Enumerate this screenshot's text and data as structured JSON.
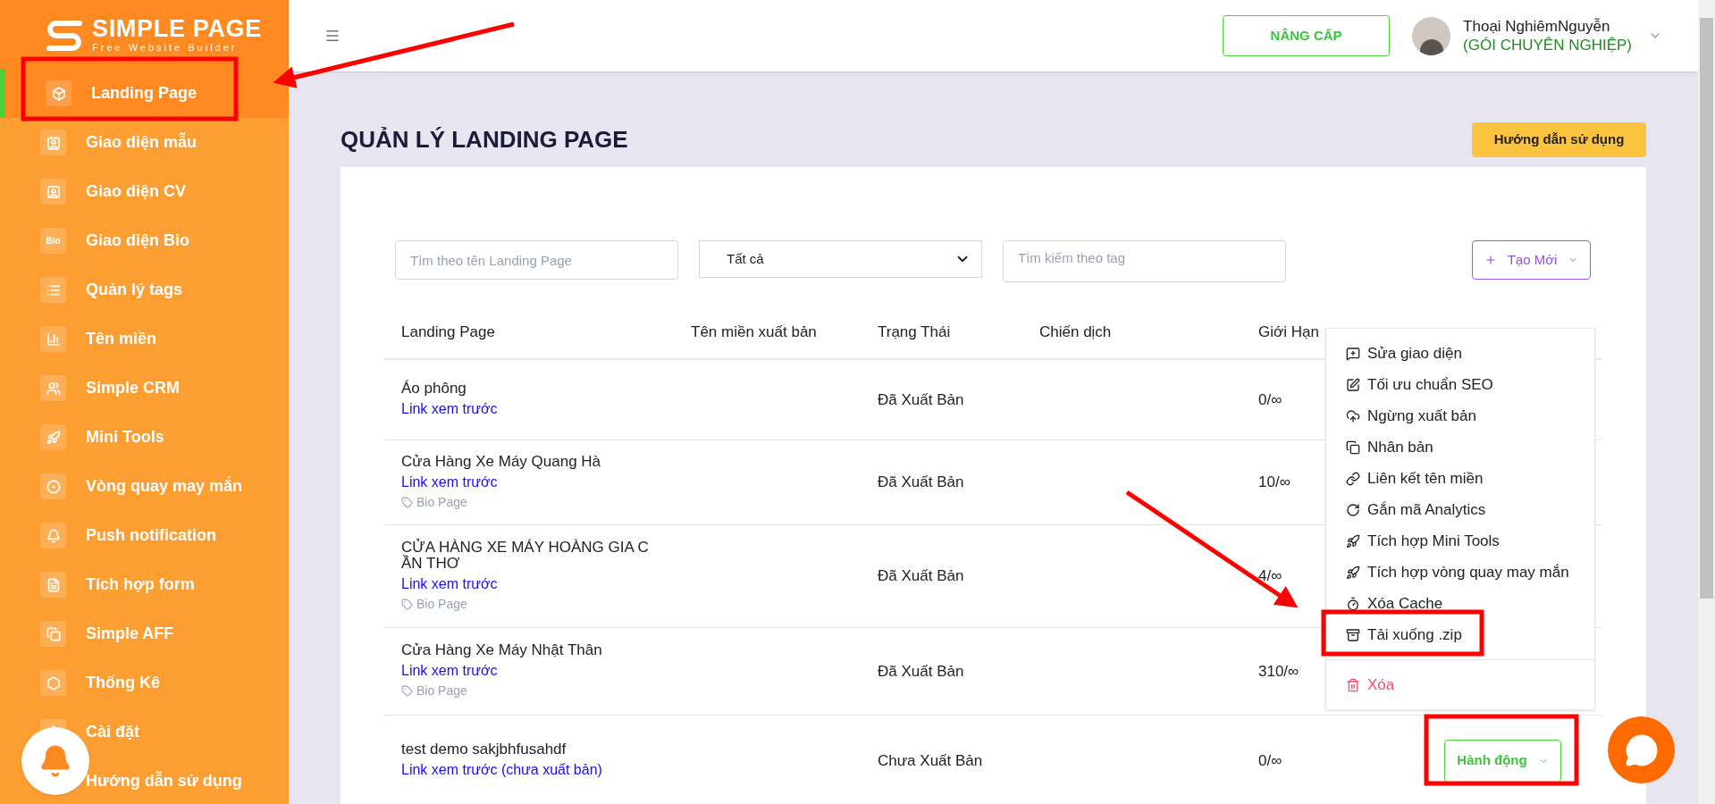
{
  "brand": {
    "name": "SIMPLE PAGE",
    "tagline": "Free Website Builder"
  },
  "sidebar": {
    "items": [
      {
        "label": "Landing Page",
        "selected": true
      },
      {
        "label": "Giao diện mẫu",
        "selected": false
      },
      {
        "label": "Giao diện CV",
        "selected": false
      },
      {
        "label": "Giao diện Bio",
        "selected": false,
        "icon_text": "Bio"
      },
      {
        "label": "Quản lý tags",
        "selected": false
      },
      {
        "label": "Tên miền",
        "selected": false
      },
      {
        "label": "Simple CRM",
        "selected": false
      },
      {
        "label": "Mini Tools",
        "selected": false
      },
      {
        "label": "Vòng quay may mắn",
        "selected": false
      },
      {
        "label": "Push notification",
        "selected": false
      },
      {
        "label": "Tích hợp form",
        "selected": false
      },
      {
        "label": "Simple AFF",
        "selected": false
      },
      {
        "label": "Thống Kê",
        "selected": false
      },
      {
        "label": "Cài đặt",
        "selected": false
      },
      {
        "label": "Hướng dẫn sử dụng",
        "selected": false
      }
    ]
  },
  "topbar": {
    "upgrade_button": "NÂNG CẤP",
    "user": {
      "name": "Thoại NghiêmNguyễn",
      "plan": "(GÓI CHUYÊN NGHIỆP)"
    }
  },
  "page": {
    "title": "QUẢN LÝ LANDING PAGE",
    "guide_button": "Hướng dẫn sử dụng"
  },
  "filters": {
    "name_search": {
      "placeholder": "Tìm theo tên Landing Page"
    },
    "status_select": {
      "value": "Tất cả"
    },
    "tag_search": {
      "placeholder": "Tìm kiếm theo tag"
    },
    "create_button": "Tạo Mới"
  },
  "table": {
    "columns": [
      "Landing Page",
      "Tên miền xuất bản",
      "Trạng Thái",
      "Chiến dịch",
      "Giới Hạn"
    ],
    "rows": [
      {
        "name": "Áo phông",
        "link": "Link xem trước",
        "status": "Đã Xuất Bản",
        "limit": "0/∞"
      },
      {
        "name": "Cửa Hàng Xe Máy Quang Hà",
        "link": "Link xem trước",
        "tag": "Bio Page",
        "status": "Đã Xuất Bản",
        "limit": "10/∞"
      },
      {
        "name": "CỬA HÀNG XE MÁY HOÀNG GIA C\nẦN THƠ",
        "link": "Link xem trước",
        "tag": "Bio Page",
        "status": "Đã Xuất Bản",
        "limit": "4/∞"
      },
      {
        "name": "Cửa Hàng Xe Máy Nhật Thân",
        "link": "Link xem trước",
        "tag": "Bio Page",
        "status": "Đã Xuất Bản",
        "limit": "310/∞"
      },
      {
        "name": "test demo sakjbhfusahdf",
        "link": "Link xem trước (chưa xuất bản)",
        "status": "Chưa Xuất Bản",
        "limit": "0/∞",
        "action": "Hành động"
      }
    ]
  },
  "action_menu": {
    "items": [
      {
        "label": "Sửa giao diện",
        "kind": "normal"
      },
      {
        "label": "Tối ưu chuẩn SEO",
        "kind": "normal"
      },
      {
        "label": "Ngừng xuất bản",
        "kind": "normal"
      },
      {
        "label": "Nhân bản",
        "kind": "normal"
      },
      {
        "label": "Liên kết tên miền",
        "kind": "normal"
      },
      {
        "label": "Gắn mã Analytics",
        "kind": "normal"
      },
      {
        "label": "Tích hợp Mini Tools",
        "kind": "normal"
      },
      {
        "label": "Tích hợp vòng quay may mắn",
        "kind": "normal"
      },
      {
        "label": "Xóa Cache",
        "kind": "normal"
      },
      {
        "label": "Tải xuống .zip",
        "kind": "normal"
      },
      {
        "label": "Xóa",
        "kind": "danger"
      }
    ]
  }
}
